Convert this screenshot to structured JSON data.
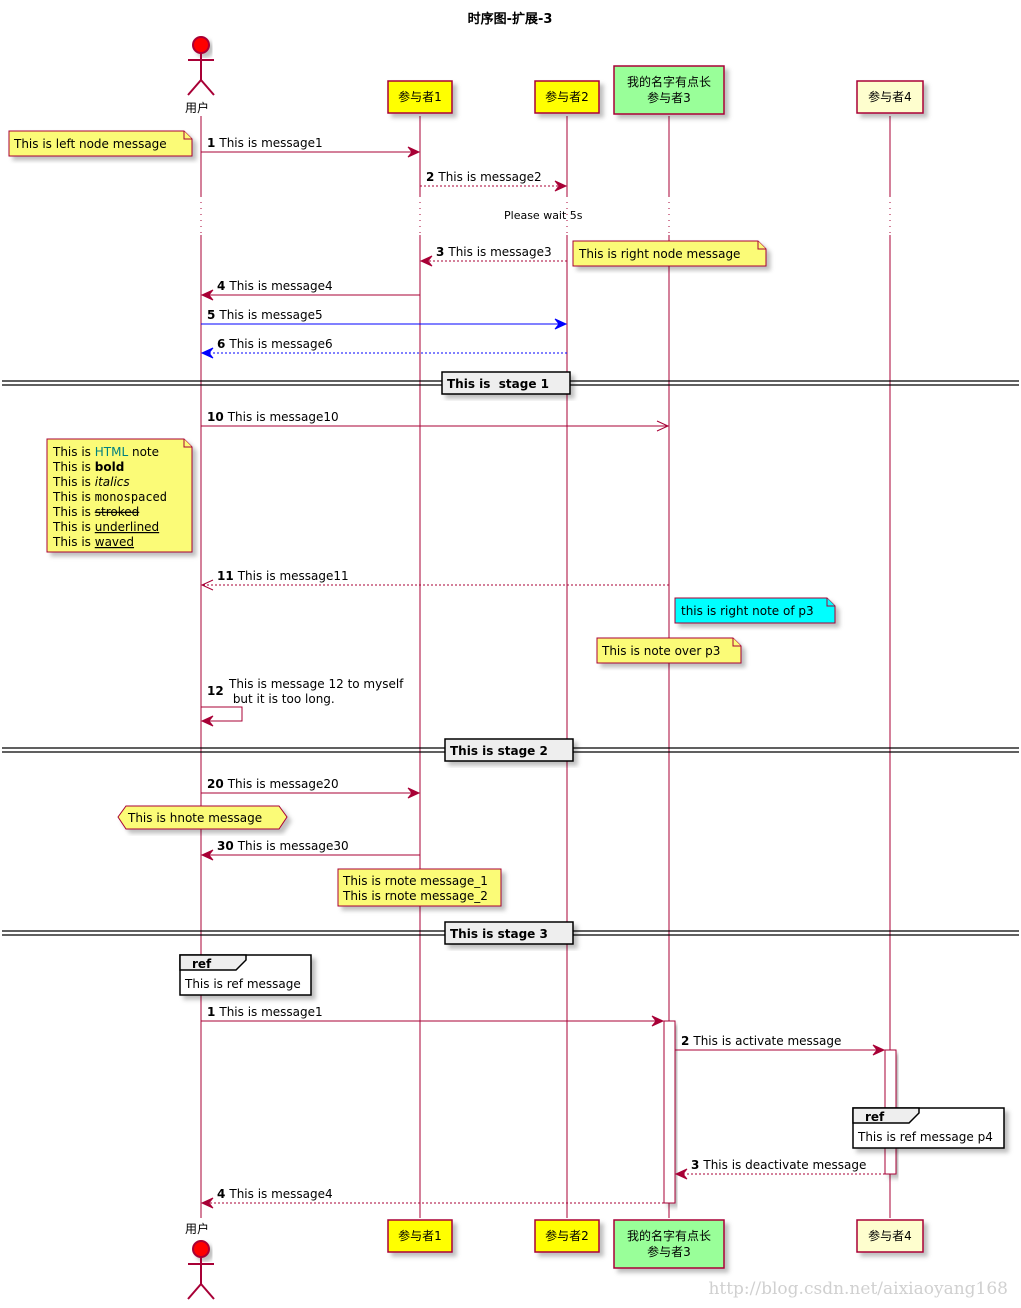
{
  "title": "时序图-扩展-3",
  "colors": {
    "line": "#A80036",
    "blue": "#0000FF",
    "note": "#FBFB77",
    "note_cyan": "#00FFFF",
    "p_yellow": "#FFFF00",
    "p_green": "#99FF99",
    "p_cream": "#FEFECE",
    "actor_red": "#FF0000",
    "divider_bg": "#EEEEEE",
    "html_teal": "#008080"
  },
  "participants": [
    {
      "id": "user",
      "type": "actor",
      "label": "用户"
    },
    {
      "id": "p1",
      "type": "box",
      "lines": [
        "参与者1"
      ],
      "fill": "p_yellow"
    },
    {
      "id": "p2",
      "type": "box",
      "lines": [
        "参与者2"
      ],
      "fill": "p_yellow"
    },
    {
      "id": "p3",
      "type": "box",
      "lines": [
        "我的名字有点长",
        "参与者3"
      ],
      "fill": "p_green"
    },
    {
      "id": "p4",
      "type": "box",
      "lines": [
        "参与者4"
      ],
      "fill": "p_cream"
    }
  ],
  "messages": [
    {
      "num": "1",
      "text": "This is message1",
      "from": "user",
      "to": "p1",
      "style": "solid",
      "color": "line"
    },
    {
      "num": "2",
      "text": "This is message2",
      "from": "p1",
      "to": "p2",
      "style": "dashed",
      "color": "line"
    },
    {
      "num": "3",
      "text": "This is message3",
      "from": "p2",
      "to": "p1",
      "style": "dashed",
      "color": "line"
    },
    {
      "num": "4",
      "text": "This is message4",
      "from": "p1",
      "to": "user",
      "style": "solid",
      "color": "line"
    },
    {
      "num": "5",
      "text": "This is message5",
      "from": "user",
      "to": "p2",
      "style": "solid",
      "color": "blue"
    },
    {
      "num": "6",
      "text": "This is message6",
      "from": "p2",
      "to": "user",
      "style": "dashed",
      "color": "blue"
    },
    {
      "num": "10",
      "text": "This is message10",
      "from": "user",
      "to": "p3",
      "style": "solid",
      "color": "line",
      "head": "open"
    },
    {
      "num": "11",
      "text": "This is message11",
      "from": "p3",
      "to": "user",
      "style": "dashed",
      "color": "line",
      "head": "open"
    },
    {
      "num": "12",
      "text": [
        "This is message 12 to myself",
        " but it is too long."
      ],
      "from": "user",
      "to": "user",
      "style": "solid",
      "color": "line",
      "self": true
    },
    {
      "num": "20",
      "text": "This is message20",
      "from": "user",
      "to": "p1",
      "style": "solid",
      "color": "line"
    },
    {
      "num": "30",
      "text": "This is message30",
      "from": "p1",
      "to": "user",
      "style": "solid",
      "color": "line"
    },
    {
      "num": "1",
      "text": "This is message1",
      "from": "user",
      "to": "p3",
      "style": "solid",
      "color": "line"
    },
    {
      "num": "2",
      "text": "This is activate message",
      "from": "p3",
      "to": "p4",
      "style": "solid",
      "color": "line"
    },
    {
      "num": "3",
      "text": "This is deactivate message",
      "from": "p4",
      "to": "p3",
      "style": "dashed",
      "color": "line"
    },
    {
      "num": "4",
      "text": "This is message4",
      "from": "p3",
      "to": "user",
      "style": "dashed",
      "color": "line"
    }
  ],
  "delay": {
    "text": "Please wait 5s"
  },
  "dividers": [
    {
      "text": "This is  stage 1"
    },
    {
      "text": "This is stage 2"
    },
    {
      "text": "This is stage 3"
    }
  ],
  "notes": {
    "left_node": "This is left node message",
    "right_node": "This is right node message",
    "html_note": [
      {
        "prefix": "This is ",
        "styled": "HTML",
        "suffix": " note",
        "style": "color"
      },
      {
        "prefix": "This is ",
        "styled": "bold",
        "suffix": "",
        "style": "bold"
      },
      {
        "prefix": "This is ",
        "styled": "italics",
        "suffix": "",
        "style": "italic"
      },
      {
        "prefix": "This is ",
        "styled": "monospaced",
        "suffix": "",
        "style": "mono"
      },
      {
        "prefix": "This is ",
        "styled": "stroked",
        "suffix": "",
        "style": "strike"
      },
      {
        "prefix": "This is ",
        "styled": "underlined",
        "suffix": "",
        "style": "underline"
      },
      {
        "prefix": "This is ",
        "styled": "waved",
        "suffix": "",
        "style": "wave"
      }
    ],
    "right_of_p3": "this is right note of p3",
    "over_p3": "This is note over p3",
    "hnote": "This is hnote message",
    "rnote": [
      "This is rnote message_1",
      "This is rnote message_2"
    ]
  },
  "refs": [
    {
      "label": "ref",
      "text": "This is ref message"
    },
    {
      "label": "ref",
      "text": "This is ref message p4"
    }
  ],
  "watermark": "http://blog.csdn.net/aixiaoyang168"
}
